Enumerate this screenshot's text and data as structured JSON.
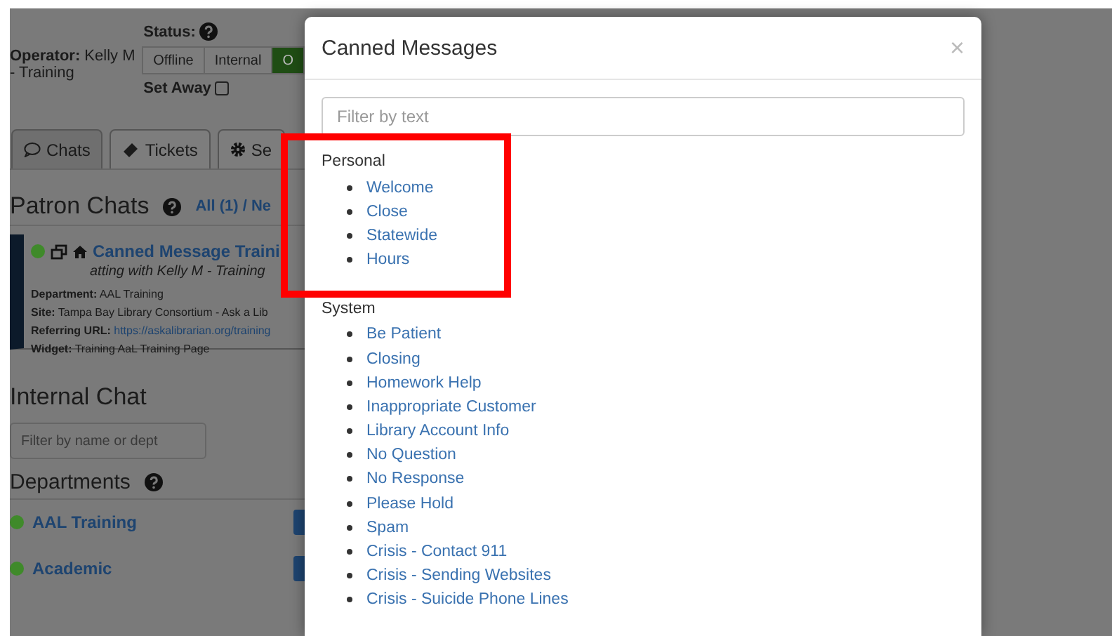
{
  "operator": {
    "label": "Operator:",
    "name": "Kelly M - Training"
  },
  "status": {
    "label": "Status:",
    "buttons": [
      {
        "label": "Offline",
        "selected": false
      },
      {
        "label": "Internal",
        "selected": false
      },
      {
        "label": "O",
        "selected": true
      }
    ],
    "away_label": "Set Away",
    "away_checked": false
  },
  "tabs": [
    {
      "label": "Chats",
      "kind": "chat",
      "selected": true
    },
    {
      "label": "Tickets",
      "kind": "ticket",
      "selected": false
    },
    {
      "label": "Se",
      "kind": "gear",
      "selected": false
    }
  ],
  "patron_chats": {
    "title": "Patron Chats",
    "filter": "All (1) / Ne",
    "chat": {
      "title": "Canned Message Traini",
      "subtitle": "atting with Kelly M - Training",
      "online": true,
      "details": [
        {
          "label": "Department:",
          "value": "AAL Training",
          "kind": "text"
        },
        {
          "label": "Site:",
          "value": "Tampa Bay Library Consortium - Ask a Lib",
          "kind": "text"
        },
        {
          "label": "Referring URL:",
          "value": "https://askalibrarian.org/training",
          "kind": "link"
        },
        {
          "label": "Widget:",
          "value": "Training AaL Training Page",
          "kind": "text"
        }
      ]
    }
  },
  "internal_chat": {
    "title": "Internal Chat",
    "placeholder": "Filter by name or dept"
  },
  "departments": {
    "title": "Departments",
    "items": [
      {
        "name": "AAL Training",
        "online": true
      },
      {
        "name": "Academic",
        "online": true
      }
    ]
  },
  "modal": {
    "title": "Canned Messages",
    "close": "×",
    "placeholder": "Filter by text",
    "groups": [
      {
        "name": "Personal",
        "items": [
          "Welcome",
          "Close",
          "Statewide",
          "Hours"
        ]
      },
      {
        "name": "System",
        "items": [
          "Be Patient",
          "Closing",
          "Homework Help",
          "Inappropriate Customer",
          "Library Account Info",
          "No Question",
          "No Response",
          "Please Hold",
          "Spam",
          "Crisis - Contact 911",
          "Crisis - Sending Websites",
          "Crisis - Suicide Phone Lines"
        ]
      }
    ]
  },
  "annotation": {
    "kind": "highlight"
  }
}
